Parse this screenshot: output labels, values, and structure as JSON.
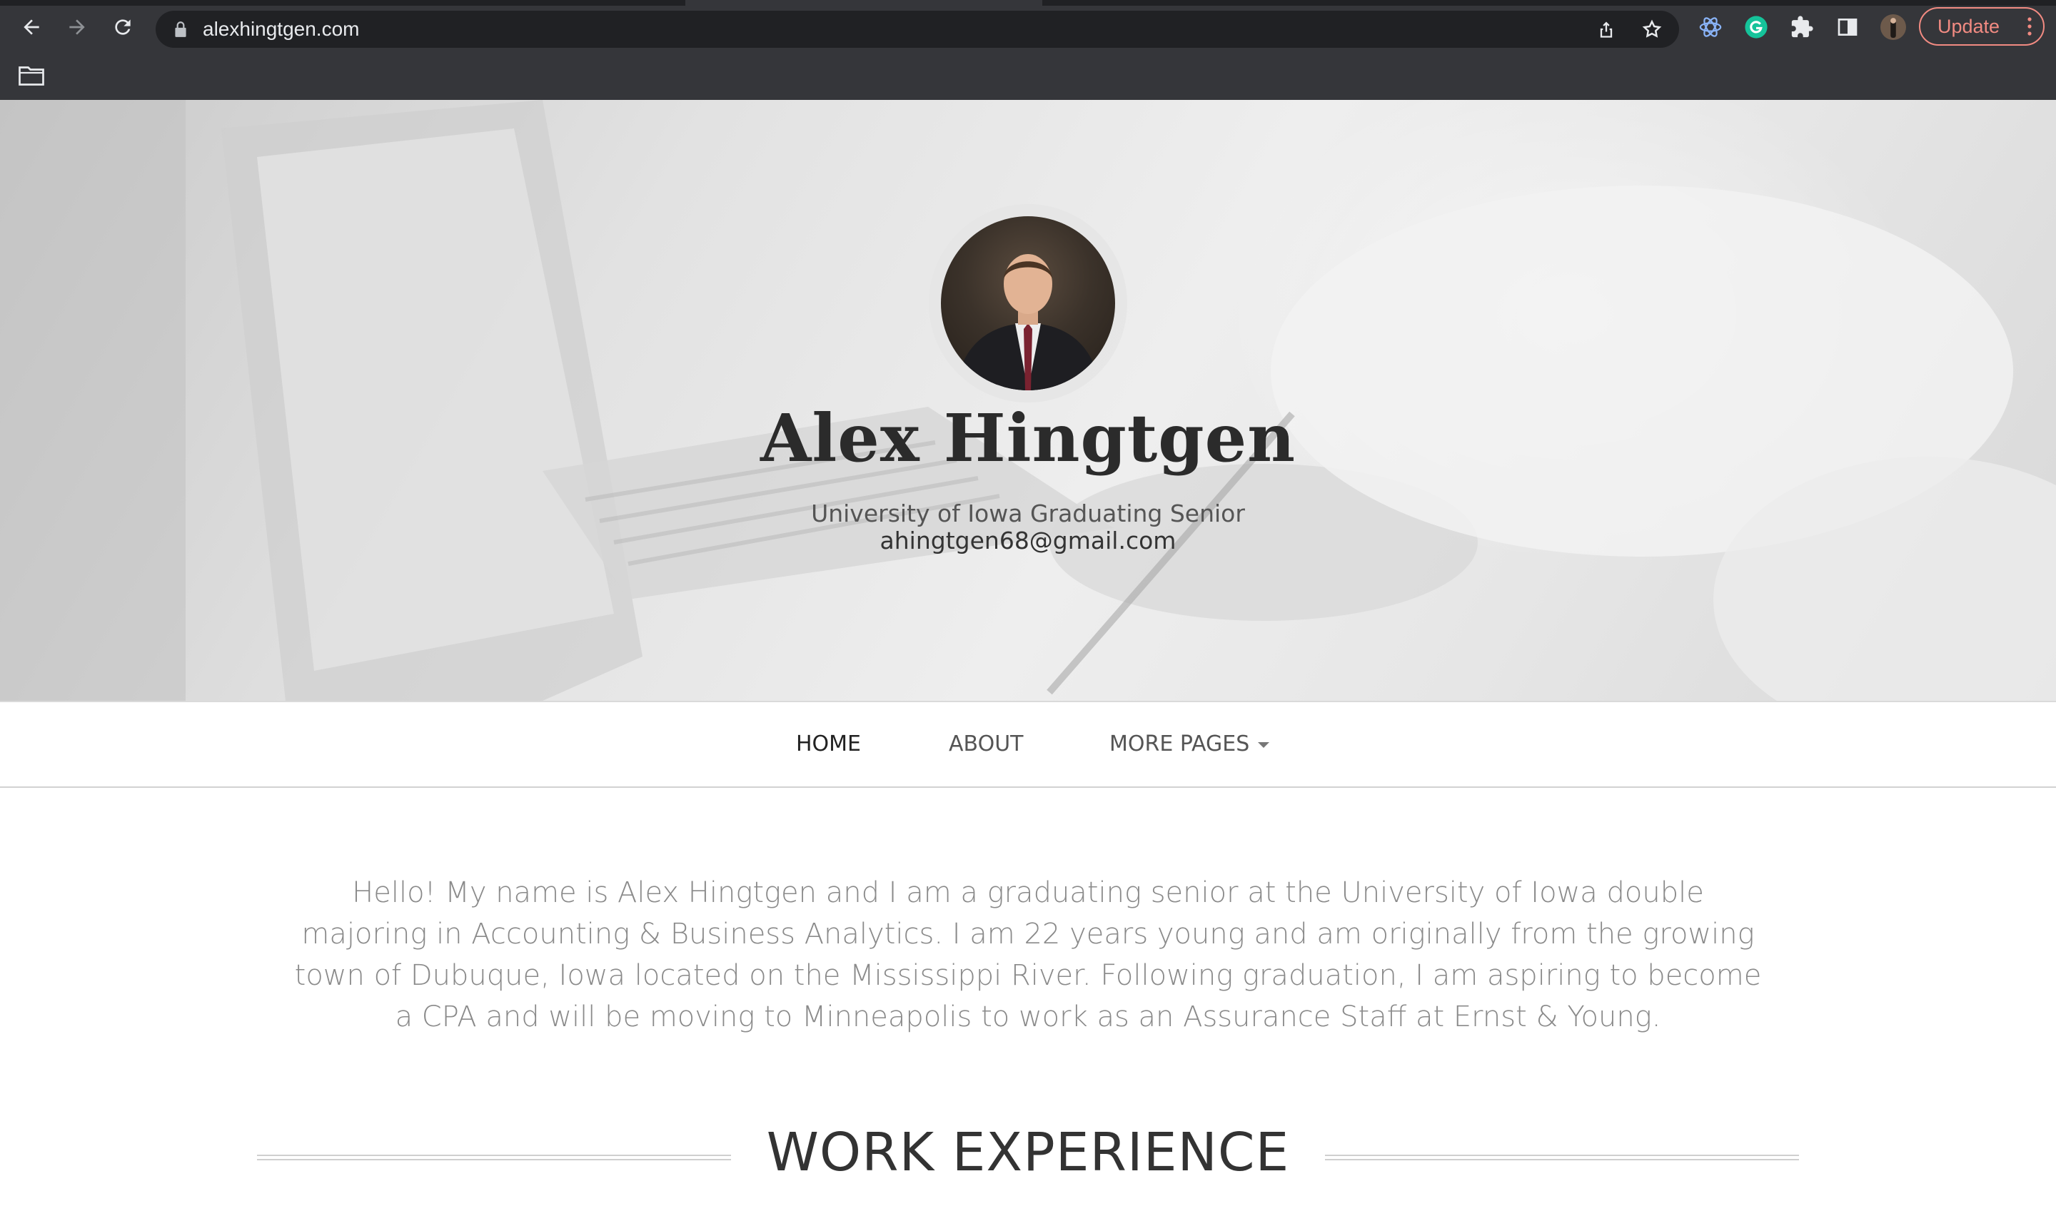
{
  "browser": {
    "url": "alexhingtgen.com",
    "update_label": "Update",
    "icons": {
      "back": "arrow-left-icon",
      "forward": "arrow-right-icon",
      "reload": "reload-icon",
      "lock": "lock-icon",
      "share": "share-icon",
      "bookmark": "star-icon",
      "extensions": "puzzle-icon",
      "side_panel": "side-panel-icon",
      "menu": "kebab-menu-icon",
      "bookmarks_folder": "folder-icon"
    },
    "colors": {
      "chrome_bg": "#35363a",
      "omnibox_bg": "#202124",
      "update_accent": "#f28b82",
      "grammarly": "#15c39a"
    }
  },
  "hero": {
    "name": "Alex Hingtgen",
    "subtitle": "University of Iowa Graduating Senior",
    "email": "ahingtgen68@gmail.com"
  },
  "nav": {
    "items": [
      {
        "label": "HOME",
        "active": true
      },
      {
        "label": "ABOUT",
        "active": false
      },
      {
        "label": "MORE PAGES",
        "active": false,
        "has_dropdown": true
      }
    ]
  },
  "main": {
    "intro": "Hello! My name is Alex Hingtgen and I am a graduating senior at the University of Iowa double majoring in Accounting & Business Analytics. I am 22 years young and am originally from the growing town of Dubuque, Iowa located on the Mississippi River. Following graduation, I am aspiring to become a CPA and will be moving to Minneapolis to work as an Assurance Staff at Ernst & Young.",
    "section_title": "WORK EXPERIENCE"
  }
}
